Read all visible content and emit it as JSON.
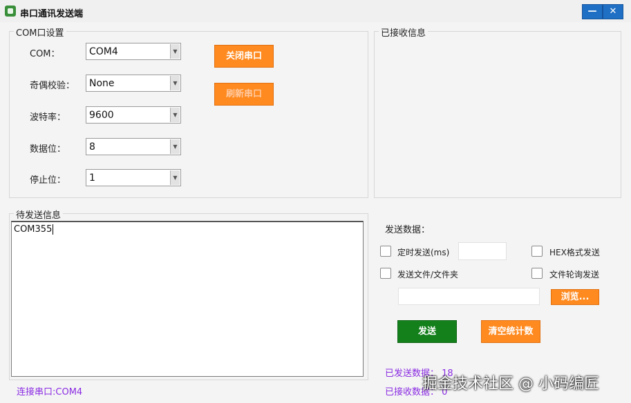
{
  "window": {
    "title": "串口通讯发送端",
    "minimize": "—",
    "close": "✕"
  },
  "com_group": {
    "legend": "COM口设置",
    "fields": [
      {
        "label": "COM：",
        "value": "COM4"
      },
      {
        "label": "奇偶校验：",
        "value": "None"
      },
      {
        "label": "波特率：",
        "value": "9600"
      },
      {
        "label": "数据位：",
        "value": "8"
      },
      {
        "label": "停止位：",
        "value": "1"
      }
    ],
    "close_port_button": "关闭串口",
    "refresh_port_button": "刷新串口"
  },
  "received_group": {
    "legend": "已接收信息",
    "content": ""
  },
  "pending_group": {
    "legend": "待发送信息",
    "content": "COM355"
  },
  "send_panel": {
    "title": "发送数据：",
    "timed_send": "定时发送(ms)",
    "timed_value": "",
    "hex_send": "HEX格式发送",
    "send_file": "发送文件/文件夹",
    "file_poll": "文件轮询发送",
    "file_path": "",
    "browse_button": "浏览...",
    "send_button": "发送",
    "clear_button": "清空统计数",
    "sent_count_label": "已发送数据：",
    "sent_count": "18",
    "recv_count_label": "已接收数据：",
    "recv_count": "0"
  },
  "status": {
    "connection": "连接串口:COM4"
  },
  "watermark": "掘金技术社区 @ 小码编匠"
}
